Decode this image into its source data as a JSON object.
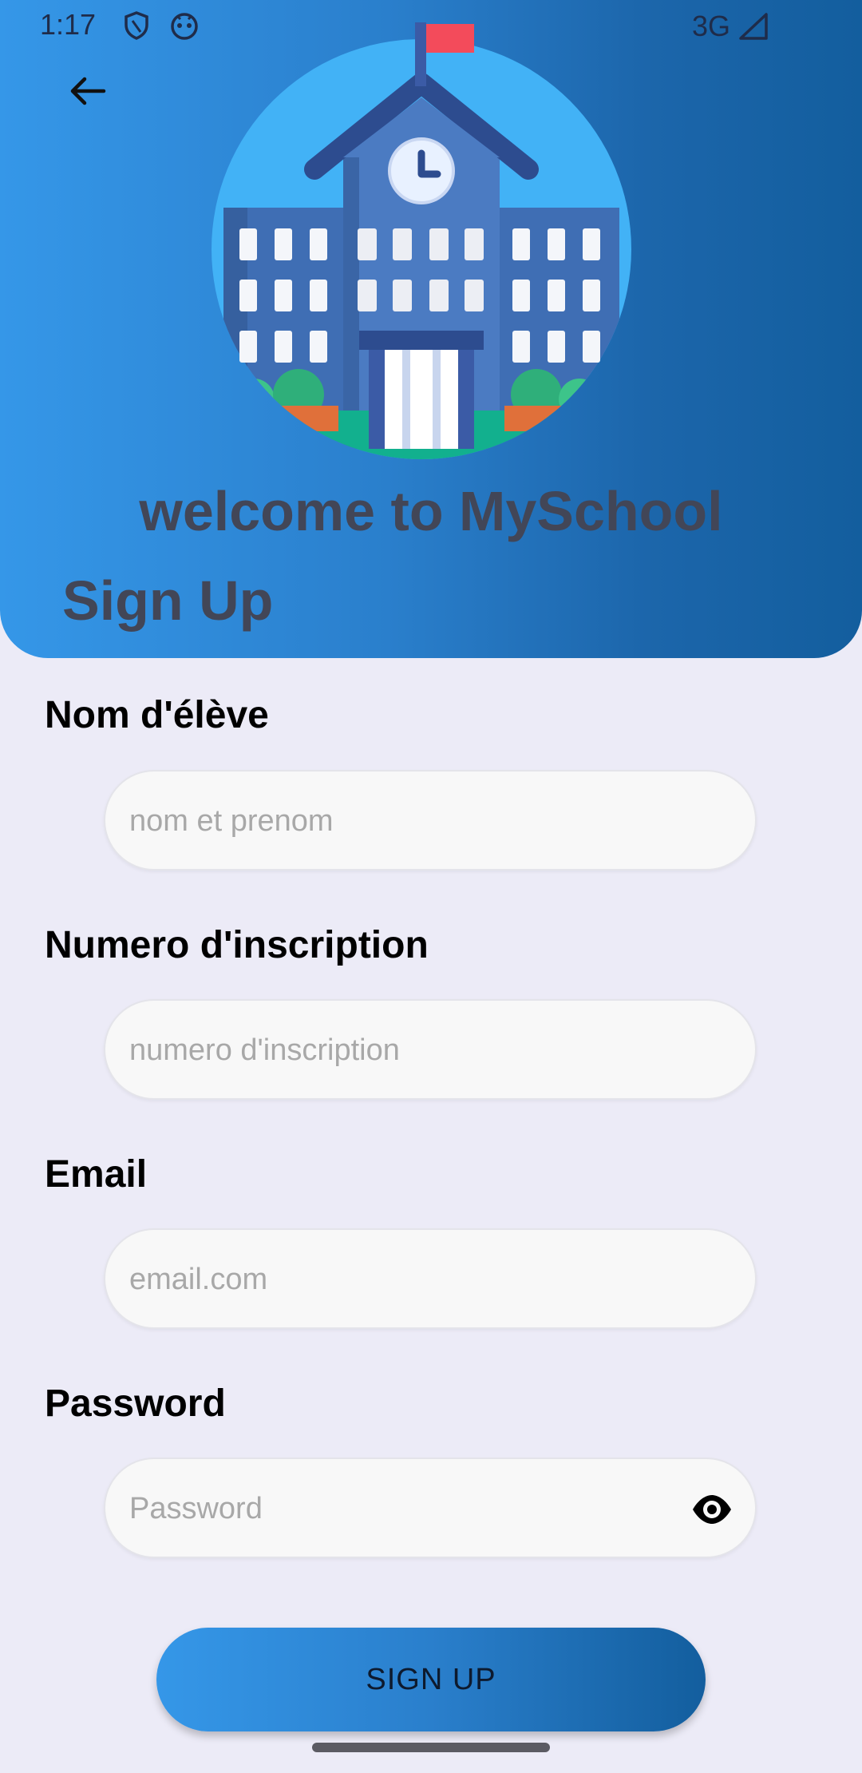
{
  "status_bar": {
    "time": "1:17",
    "network": "3G"
  },
  "header": {
    "welcome_text": "welcome to MySchool",
    "title": "Sign Up",
    "illustration": "school-building"
  },
  "form": {
    "student_name": {
      "label": "Nom d'élève",
      "placeholder": "nom et prenom",
      "value": ""
    },
    "registration_number": {
      "label": "Numero d'inscription",
      "placeholder": "numero d'inscription",
      "value": ""
    },
    "email": {
      "label": "Email",
      "placeholder": "email.com",
      "value": ""
    },
    "password": {
      "label": "Password",
      "placeholder": "Password",
      "value": ""
    }
  },
  "actions": {
    "signup_label": "SIGN UP"
  },
  "colors": {
    "gradient_start": "#3597E8",
    "gradient_end": "#135E9E",
    "background": "#ECEBF7",
    "heading_text": "#424657"
  }
}
